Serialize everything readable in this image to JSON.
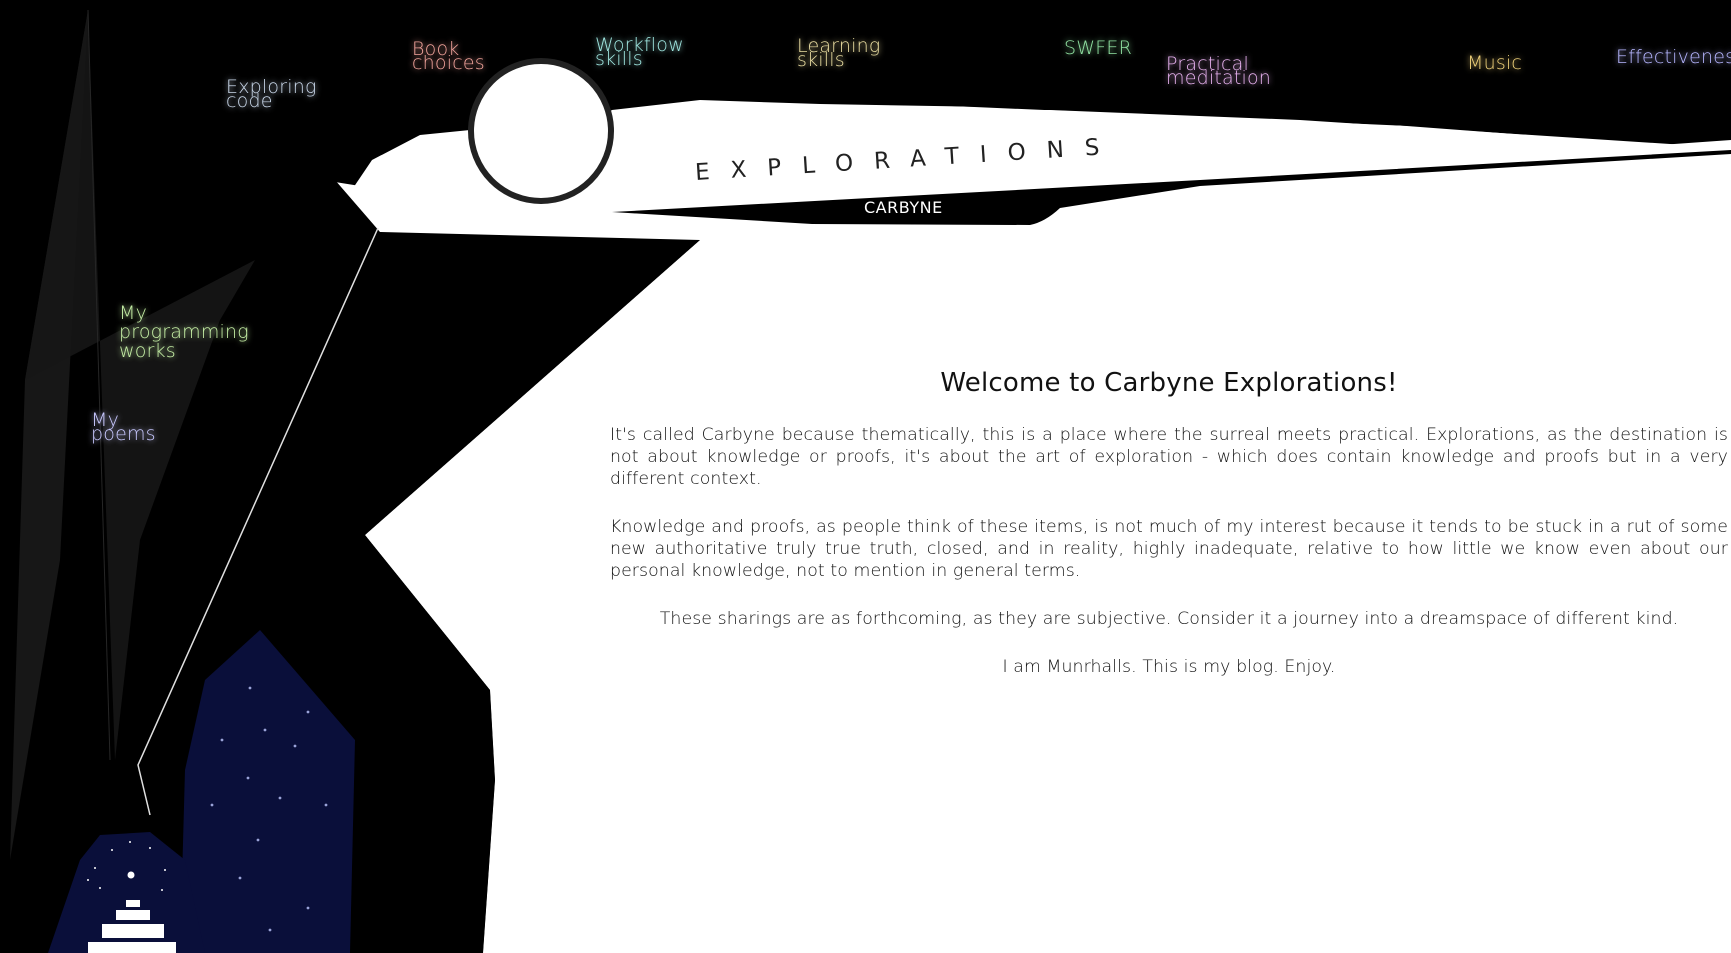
{
  "site": {
    "title": "EXPLORATIONS",
    "subtitle": "CARBYNE"
  },
  "nav": {
    "items": [
      {
        "id": "exploring-code",
        "label": "Exploring\ncode",
        "color": "#c8d6e8"
      },
      {
        "id": "book-choices",
        "label": "Book\nchoices",
        "color": "#f0a29a"
      },
      {
        "id": "workflow-skills",
        "label": "Workflow\nskills",
        "color": "#9fe6e0"
      },
      {
        "id": "learning-skills",
        "label": "Learning\nskills",
        "color": "#e8dca0"
      },
      {
        "id": "swfer",
        "label": "SWFER",
        "color": "#8fe0a0"
      },
      {
        "id": "practical-meditation",
        "label": "Practical\nmeditation",
        "color": "#e6b0ee"
      },
      {
        "id": "music",
        "label": "Music",
        "color": "#f0d27a"
      },
      {
        "id": "effectiveness",
        "label": "Effectiveness",
        "color": "#b6b6ff"
      },
      {
        "id": "my-programming-works",
        "label": "My\nprogramming\nworks",
        "color": "#c6f0a6"
      },
      {
        "id": "my-poems",
        "label": "My\npoems",
        "color": "#c8c8ff"
      }
    ]
  },
  "main": {
    "heading": "Welcome to Carbyne Explorations!",
    "paragraphs": [
      "It's called Carbyne because thematically, this is a place where the surreal meets practical. Explorations, as the destination is not about knowledge or proofs, it's about the art of exploration - which does contain knowledge and proofs but in a very different context.",
      "Knowledge and proofs, as people think of these items, is not much of my interest because it tends to be stuck in a rut of some new authoritative truly true truth, closed, and in reality, highly inadequate, relative to how little we know even about our personal knowledge, not to mention in general terms.",
      "These sharings are as forthcoming, as they are subjective. Consider it a journey into a dreamspace of different kind.",
      "I am Munrhalls. This is my blog. Enjoy."
    ]
  },
  "colors": {
    "background": "#ffffff",
    "art_black": "#000000",
    "night_sky": "#0a0f3a"
  }
}
